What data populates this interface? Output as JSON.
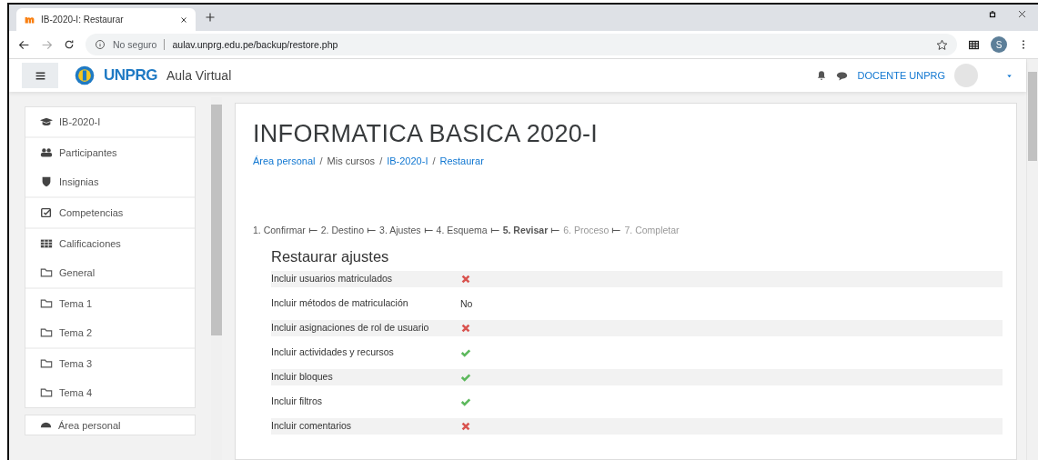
{
  "browser": {
    "tab": {
      "title": "IB-2020-I: Restaurar",
      "selected": true
    },
    "security": "No seguro",
    "url": "aulav.unprg.edu.pe/backup/restore.php",
    "profile": "S"
  },
  "header": {
    "logo": "UNPRG",
    "site": "Aula Virtual",
    "user": "DOCENTE UNPRG"
  },
  "sidebar": {
    "groups": [
      [
        {
          "label": "IB-2020-I",
          "kind": "course"
        }
      ],
      [
        {
          "label": "Participantes",
          "kind": "users"
        },
        {
          "label": "Insignias",
          "kind": "badges"
        }
      ],
      [
        {
          "label": "Competencias",
          "kind": "competencies"
        }
      ],
      [
        {
          "label": "Calificaciones",
          "kind": "grades"
        },
        {
          "label": "General",
          "kind": "section"
        }
      ],
      [
        {
          "label": "Tema 1",
          "kind": "section"
        },
        {
          "label": "Tema 2",
          "kind": "section"
        }
      ],
      [
        {
          "label": "Tema 3",
          "kind": "section"
        },
        {
          "label": "Tema 4",
          "kind": "section"
        }
      ],
      [
        {
          "label": "Área personal",
          "kind": "dashboard"
        }
      ]
    ]
  },
  "page": {
    "title": "INFORMATICA BASICA 2020-I",
    "breadcrumb": [
      {
        "label": "Área personal",
        "link": true
      },
      {
        "label": "Mis cursos",
        "link": false,
        "separator": "/"
      },
      {
        "label": "IB-2020-I",
        "link": true,
        "separator": "/"
      },
      {
        "label": "Restaurar",
        "link": true,
        "separator": "/"
      }
    ],
    "steps": [
      {
        "label": "1. Confirmar",
        "selected": false,
        "disabled": false
      },
      {
        "label": "2. Destino",
        "selected": false,
        "disabled": false
      },
      {
        "label": "3. Ajustes",
        "selected": false,
        "disabled": false
      },
      {
        "label": "4. Esquema",
        "selected": false,
        "disabled": false
      },
      {
        "label": "5. Revisar",
        "selected": true,
        "disabled": false
      },
      {
        "label": "6. Proceso",
        "selected": false,
        "disabled": true
      },
      {
        "label": "7. Completar",
        "selected": false,
        "disabled": true
      }
    ],
    "section": "Restaurar ajustes",
    "settings": [
      {
        "label": "Incluir usuarios matriculados",
        "kind": "cross"
      },
      {
        "label": "Incluir métodos de matriculación",
        "kind": "text",
        "value": "No"
      },
      {
        "label": "Incluir asignaciones de rol de usuario",
        "kind": "cross"
      },
      {
        "label": "Incluir actividades y recursos",
        "kind": "check"
      },
      {
        "label": "Incluir bloques",
        "kind": "check"
      },
      {
        "label": "Incluir filtros",
        "kind": "check"
      },
      {
        "label": "Incluir comentarios",
        "kind": "cross"
      }
    ]
  }
}
